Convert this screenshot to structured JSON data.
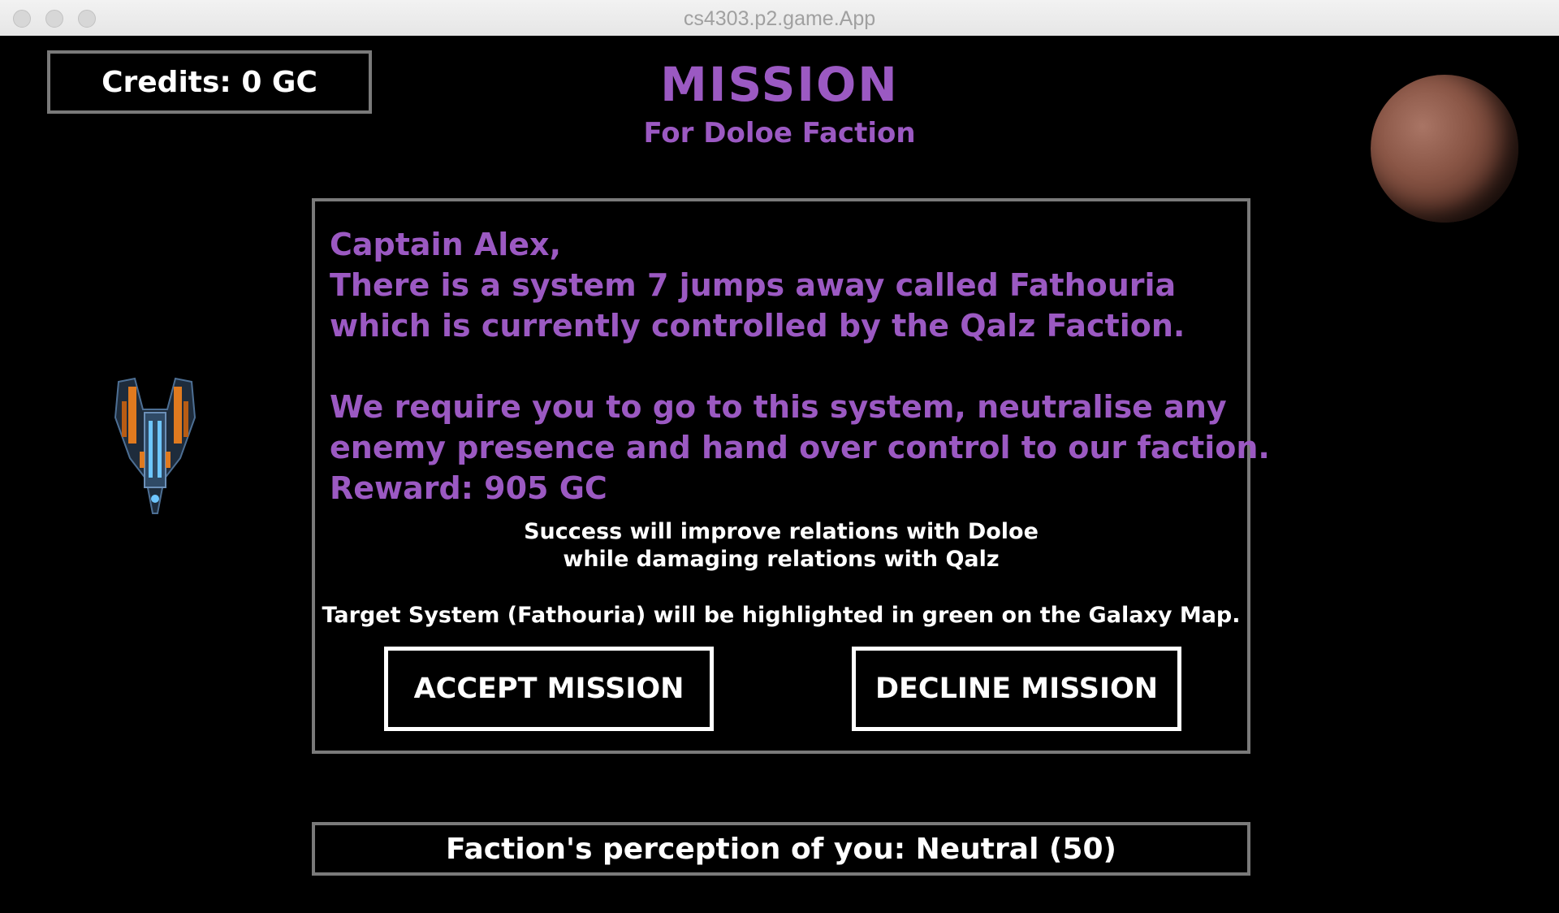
{
  "window": {
    "title": "cs4303.p2.game.App"
  },
  "hud": {
    "credits": "Credits: 0 GC"
  },
  "mission": {
    "title": "MISSION",
    "subtitle": "For Doloe Faction",
    "letter_lines": [
      "Captain Alex,",
      "There is a system 7 jumps away called Fathouria",
      "which is currently controlled by the Qalz Faction.",
      "",
      "We require you to go to this system, neutralise any",
      "enemy presence and hand over control to our faction.",
      "Reward: 905 GC"
    ],
    "relations_line1": "Success will improve relations with Doloe",
    "relations_line2": "while damaging relations with Qalz",
    "target_note": "Target System (Fathouria) will be highlighted in green on the Galaxy Map.",
    "accept_label": "ACCEPT MISSION",
    "decline_label": "DECLINE MISSION"
  },
  "perception": "Faction's perception of you: Neutral (50)",
  "icons": {
    "planet": "planet-icon",
    "ship": "spaceship-icon"
  },
  "colors": {
    "accent_purple": "#9b59c2",
    "panel_border": "#7a7a7a",
    "background": "#000000",
    "text": "#ffffff"
  }
}
